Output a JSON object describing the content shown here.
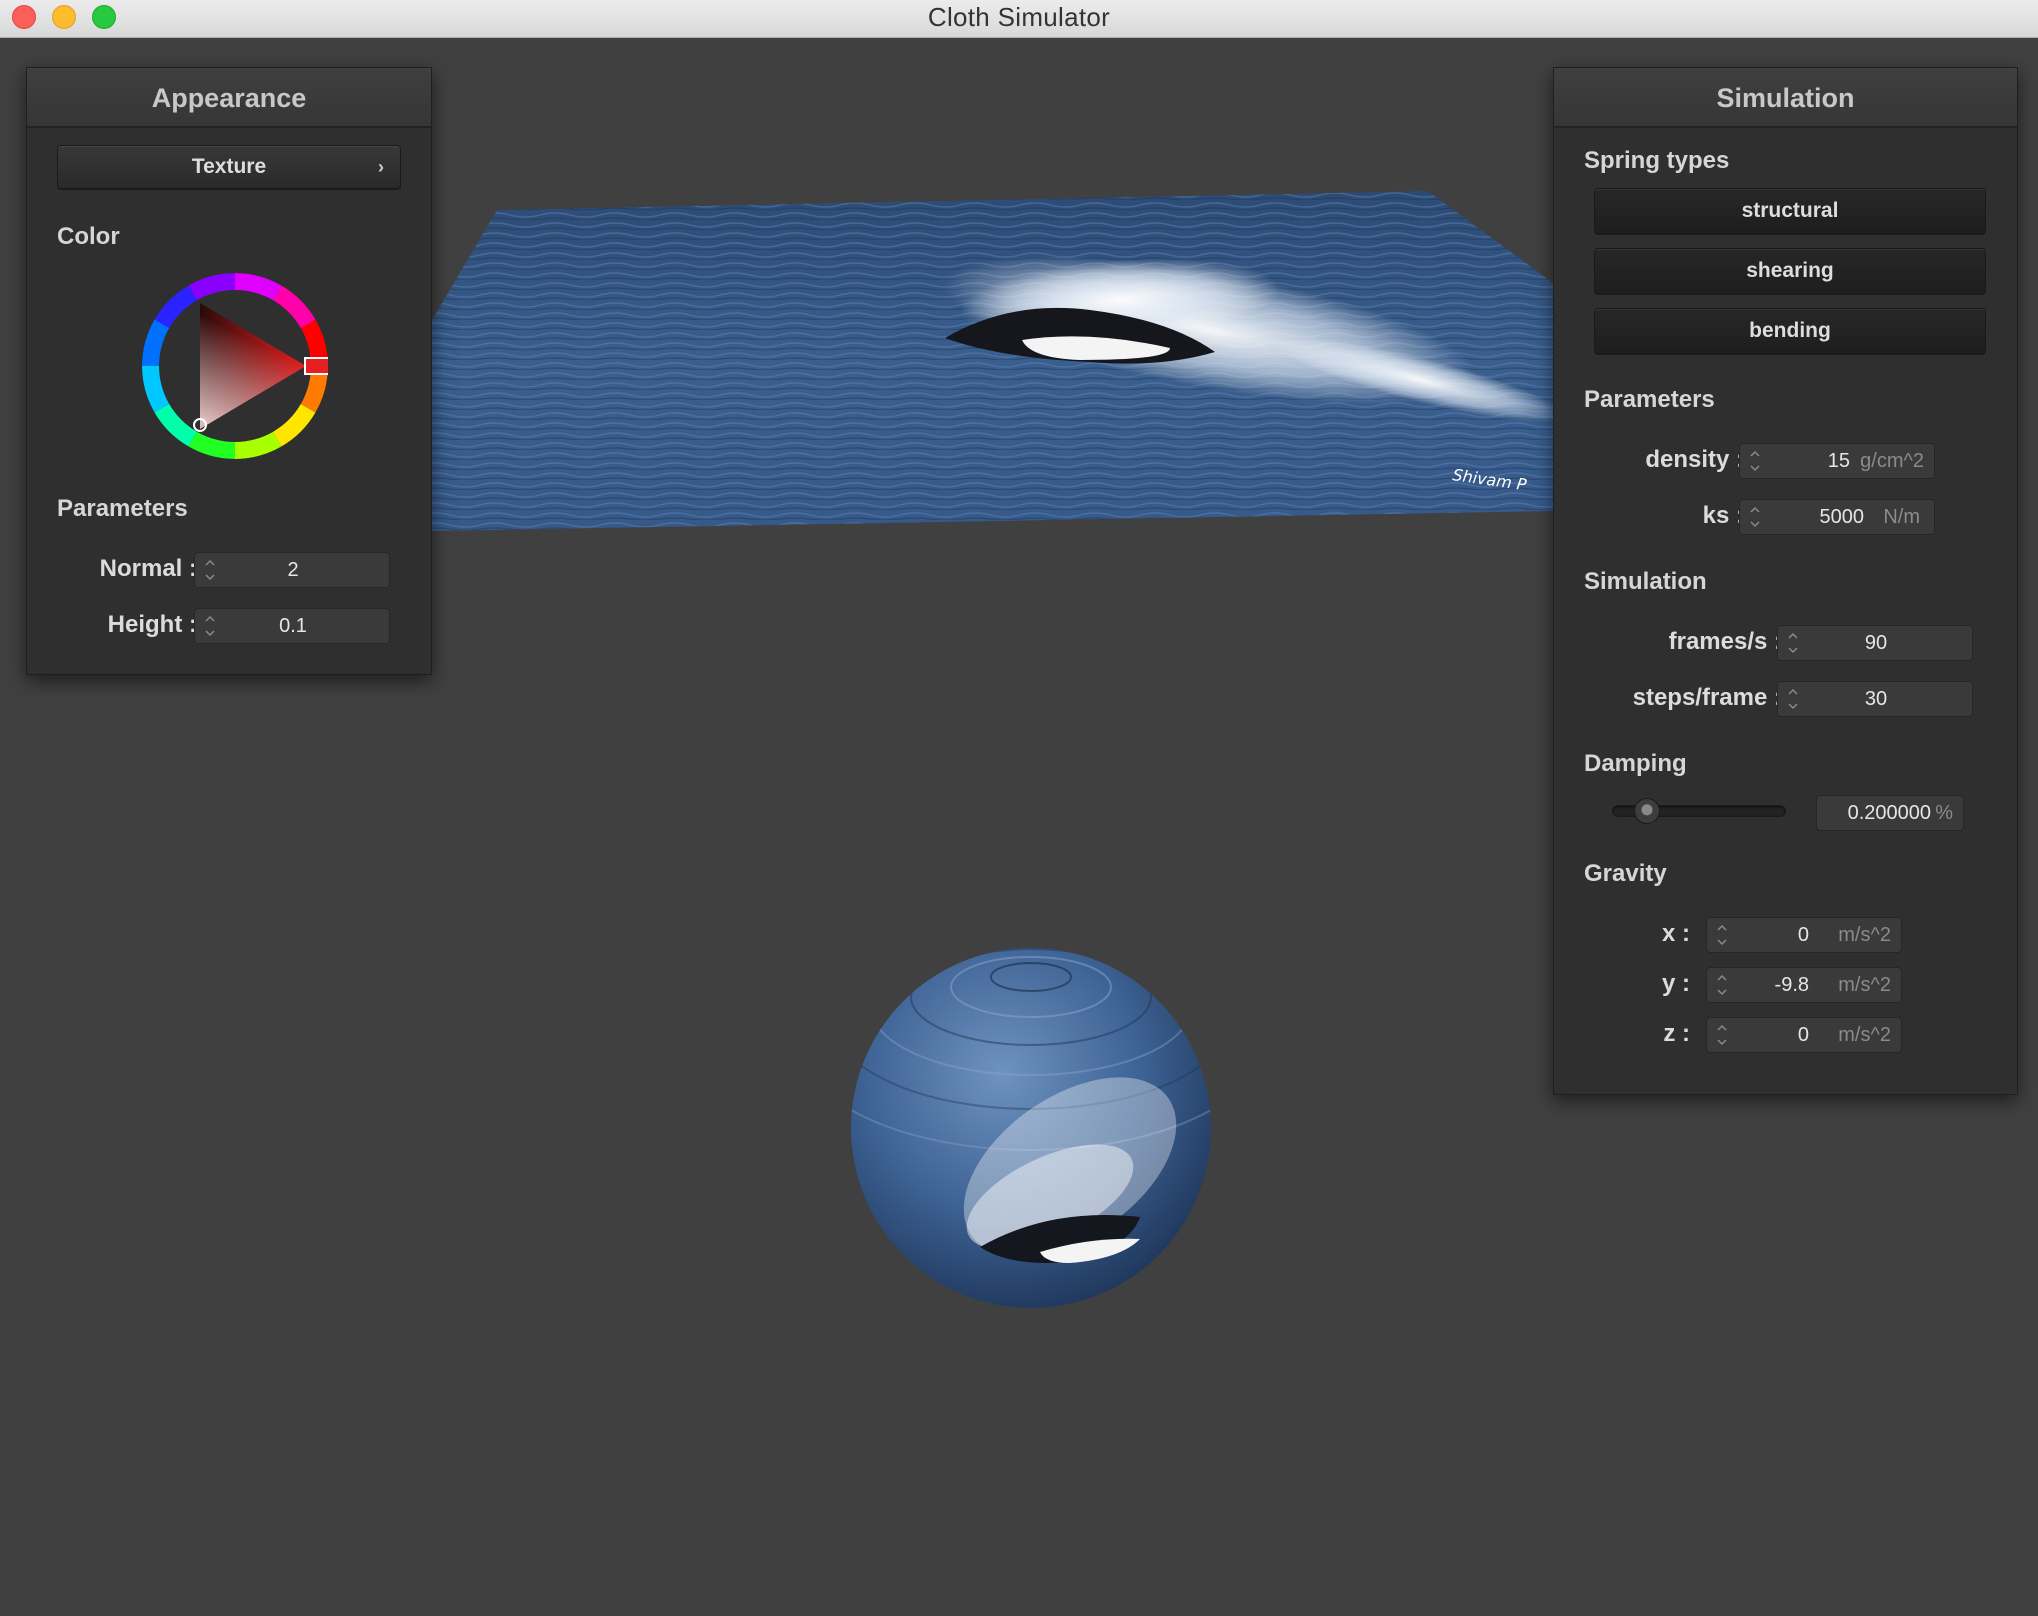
{
  "window": {
    "title": "Cloth Simulator"
  },
  "cloth_texture": {
    "watermark": "Shivam P"
  },
  "appearance": {
    "header": "Appearance",
    "texture_button": "Texture",
    "color_label": "Color",
    "parameters_label": "Parameters",
    "normal_label": "Normal :",
    "normal_value": "2",
    "height_label": "Height :",
    "height_value": "0.1",
    "selected_color": "#e62020"
  },
  "simulation": {
    "header": "Simulation",
    "spring_types_label": "Spring types",
    "spring_types": [
      "structural",
      "shearing",
      "bending"
    ],
    "parameters_label": "Parameters",
    "density_label": "density :",
    "density_value": "15",
    "density_unit": "g/cm^2",
    "ks_label": "ks :",
    "ks_value": "5000",
    "ks_unit": "N/m",
    "simulation_label": "Simulation",
    "fps_label": "frames/s :",
    "fps_value": "90",
    "steps_label": "steps/frame :",
    "steps_value": "30",
    "damping_label": "Damping",
    "damping_value": "0.200000",
    "damping_unit": "%",
    "damping_slider_fraction": 0.2,
    "gravity_label": "Gravity",
    "gx_label": "x :",
    "gx_value": "0",
    "gy_label": "y :",
    "gy_value": "-9.8",
    "gz_label": "z :",
    "gz_value": "0",
    "gravity_unit": "m/s^2"
  },
  "colors": {
    "water": "#3a5f8e",
    "panel": "#2f2f2f",
    "background": "#404040"
  }
}
